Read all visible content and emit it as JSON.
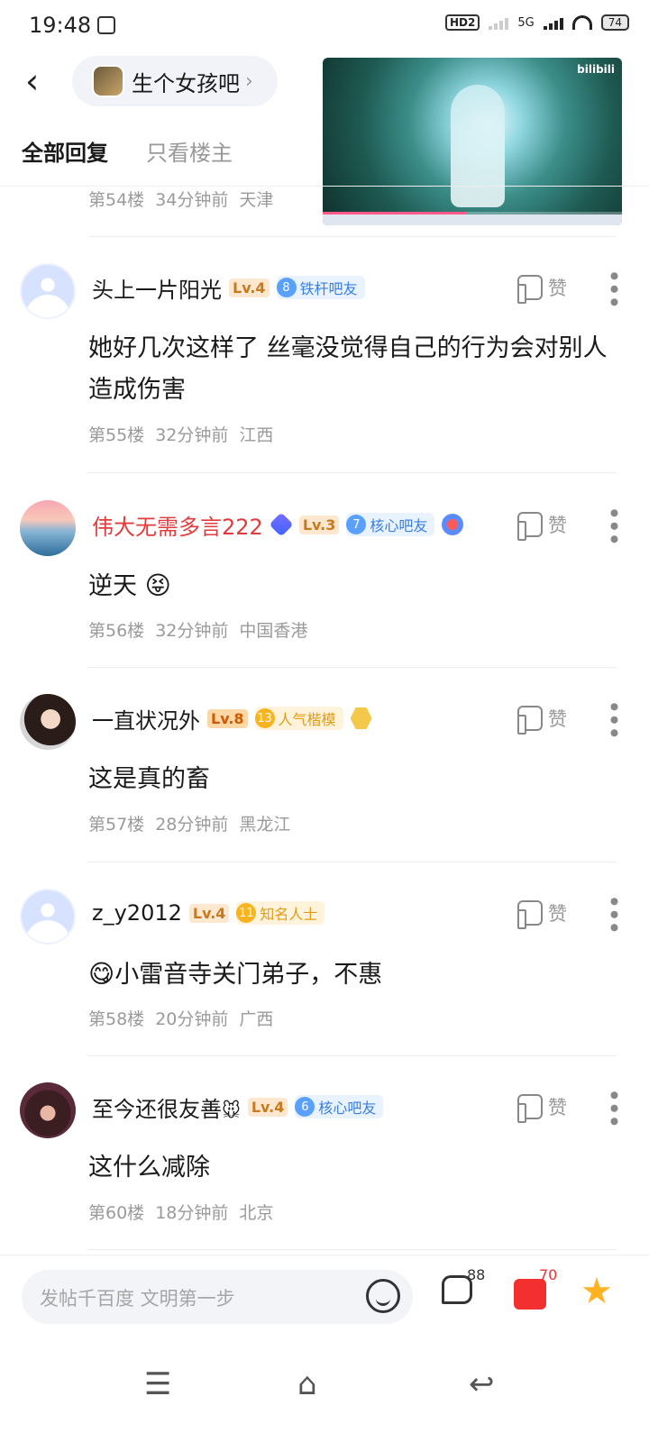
{
  "status": {
    "time": "19:48",
    "network": "5G",
    "hd": "HD2",
    "battery": "74"
  },
  "header": {
    "back_icon": "chevron-left-icon",
    "forum_name": "生个女孩吧",
    "forum_arrow": "›"
  },
  "video": {
    "logo": "bilibili",
    "progress_percent": 48
  },
  "tabs": [
    {
      "label": "全部回复",
      "active": true
    },
    {
      "label": "只看楼主",
      "active": false
    }
  ],
  "first_meta": {
    "floor": "第54楼",
    "time": "34分钟前",
    "location": "天津"
  },
  "comments": [
    {
      "name": "头上一片阳光",
      "level": "Lv.4",
      "badge_num": "8",
      "badge_label": "铁杆吧友",
      "content": "她好几次这样了 丝毫没觉得自己的行为会对别人造成伤害",
      "floor": "第55楼",
      "time": "32分钟前",
      "location": "江西",
      "like": "赞"
    },
    {
      "name": "伟大无需多言222",
      "level": "Lv.3",
      "badge_num": "7",
      "badge_label": "核心吧友",
      "content": "逆天",
      "emoji": "😝",
      "floor": "第56楼",
      "time": "32分钟前",
      "location": "中国香港",
      "like": "赞"
    },
    {
      "name": "一直状况外",
      "level": "Lv.8",
      "badge_num": "13",
      "badge_label": "人气楷模",
      "content": "这是真的畜",
      "floor": "第57楼",
      "time": "28分钟前",
      "location": "黑龙江",
      "like": "赞"
    },
    {
      "name": "z_y2012",
      "level": "Lv.4",
      "badge_num": "11",
      "badge_label": "知名人士",
      "emoji": "😋",
      "content": "小雷音寺关门弟子，不惠",
      "floor": "第58楼",
      "time": "20分钟前",
      "location": "广西",
      "like": "赞"
    },
    {
      "name": "至今还很友善",
      "name_emoji": "🐭",
      "level": "Lv.4",
      "badge_num": "6",
      "badge_label": "核心吧友",
      "content": "这什么减除",
      "floor": "第60楼",
      "time": "18分钟前",
      "location": "北京",
      "like": "赞"
    }
  ],
  "bottom": {
    "placeholder": "发帖千百度 文明第一步",
    "reply_count": "88",
    "agree_count": "70",
    "fav_icon": "★"
  },
  "navbar": {
    "menu": "☰",
    "home": "⌂",
    "back": "↩"
  }
}
